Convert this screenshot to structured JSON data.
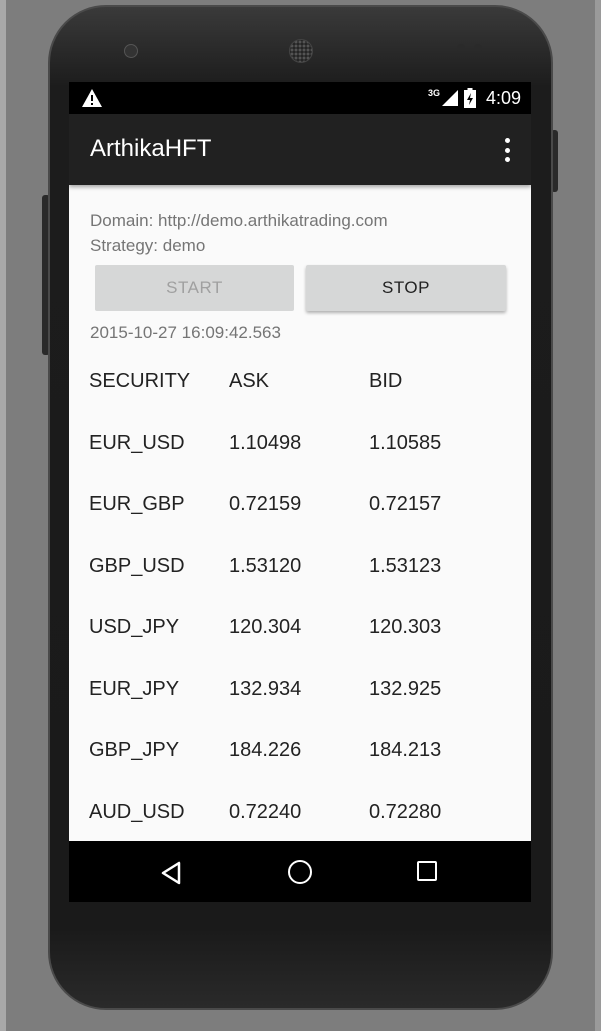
{
  "statusbar": {
    "warning_icon": "warning-icon",
    "network_label": "3G",
    "signal_icon": "signal-icon",
    "battery_icon": "battery-charging-icon",
    "time": "4:09"
  },
  "appbar": {
    "title": "ArthikaHFT",
    "menu_icon": "overflow-menu-icon"
  },
  "info": {
    "domain": "Domain: http://demo.arthikatrading.com",
    "strategy": "Strategy: demo"
  },
  "actions": {
    "start_label": "START",
    "stop_label": "STOP"
  },
  "timestamp": "2015-10-27 16:09:42.563",
  "quotes": {
    "headers": [
      "SECURITY",
      "ASK",
      "BID"
    ],
    "rows": [
      [
        "EUR_USD",
        "1.10498",
        "1.10585"
      ],
      [
        "EUR_GBP",
        "0.72159",
        "0.72157"
      ],
      [
        "GBP_USD",
        "1.53120",
        "1.53123"
      ],
      [
        "USD_JPY",
        "120.304",
        "120.303"
      ],
      [
        "EUR_JPY",
        "132.934",
        "132.925"
      ],
      [
        "GBP_JPY",
        "184.226",
        "184.213"
      ],
      [
        "AUD_USD",
        "0.72240",
        "0.72280"
      ]
    ]
  },
  "navbar": {
    "back_icon": "back-triangle-icon",
    "home_icon": "home-circle-icon",
    "recents_icon": "recents-square-icon"
  },
  "colors": {
    "appbar": "#212121",
    "statusbar": "#000000",
    "content_bg": "#fafafa",
    "button_bg": "#d6d7d7",
    "secondary_text": "#757575"
  }
}
